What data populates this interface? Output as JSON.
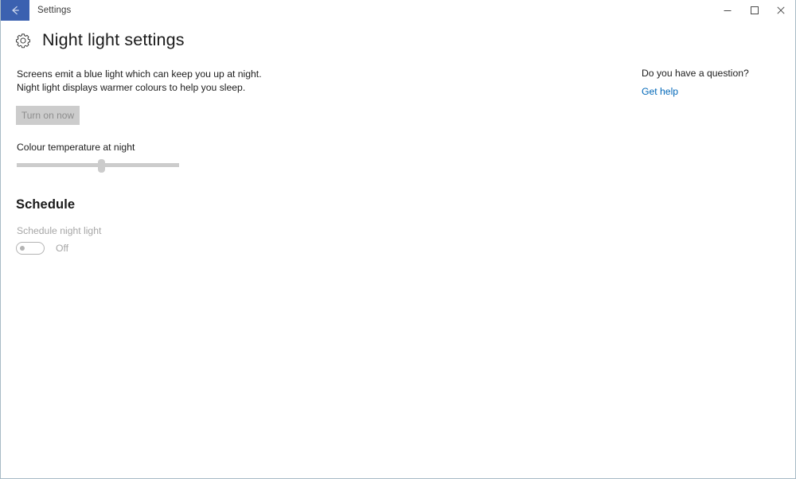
{
  "window": {
    "titlebar": {
      "title": "Settings",
      "back_icon": "back-arrow-icon",
      "minimize_icon": "minimize-icon",
      "maximize_icon": "maximize-icon",
      "close_icon": "close-icon",
      "accent_color": "#3b61b0"
    },
    "border_color": "#a8bac6",
    "background_color": "#ffffff"
  },
  "header": {
    "icon": "gear-icon",
    "title": "Night light settings"
  },
  "main": {
    "description": "Screens emit a blue light which can keep you up at night. Night light displays warmer colours to help you sleep.",
    "turn_on_button": {
      "label": "Turn on now",
      "enabled": false,
      "background_color": "#cccccc",
      "text_color": "#8d8d8d"
    },
    "colour_temperature": {
      "label": "Colour temperature at night",
      "value_percent": 52,
      "enabled": false,
      "track_color": "#cccccc"
    },
    "schedule": {
      "heading": "Schedule",
      "toggle_label": "Schedule night light",
      "toggle_state": "Off",
      "toggle_on": false
    }
  },
  "help": {
    "heading": "Do you have a question?",
    "link_label": "Get help",
    "link_color": "#0067b8"
  }
}
